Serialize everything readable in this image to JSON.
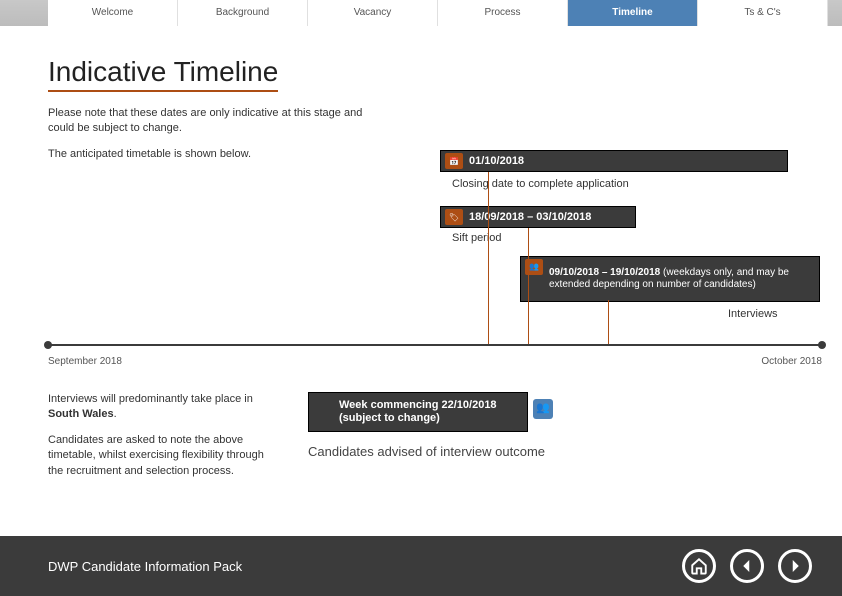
{
  "tabs": [
    "Welcome",
    "Background",
    "Vacancy",
    "Process",
    "Timeline",
    "Ts & C's"
  ],
  "activeTab": 4,
  "title": "Indicative Timeline",
  "intro1": "Please note that these dates are only indicative at this stage and could be subject to change.",
  "intro2": "The anticipated timetable is shown below.",
  "bar1_date": "01/10/2018",
  "bar1_caption": "Closing date to complete application",
  "bar2_date": "18/09/2018 – 03/10/2018",
  "bar2_caption": "Sift period",
  "bar3_date": "09/10/2018 – 19/10/2018",
  "bar3_note": " (weekdays only, and may be extended depending on number of candidates)",
  "bar3_caption": "Interviews",
  "monthL": "September 2018",
  "monthR": "October 2018",
  "lower1a": "Interviews will predominantly take place in ",
  "lower1b": "South Wales",
  "lower1c": ".",
  "lower2": "Candidates are asked to note the above timetable, whilst exercising flexibility through the recruitment and selection process.",
  "week_a": "Week commencing ",
  "week_b": "22/10/2018",
  "week_c": " (subject to change)",
  "outcome": "Candidates advised of interview outcome",
  "footer": "DWP Candidate Information Pack"
}
